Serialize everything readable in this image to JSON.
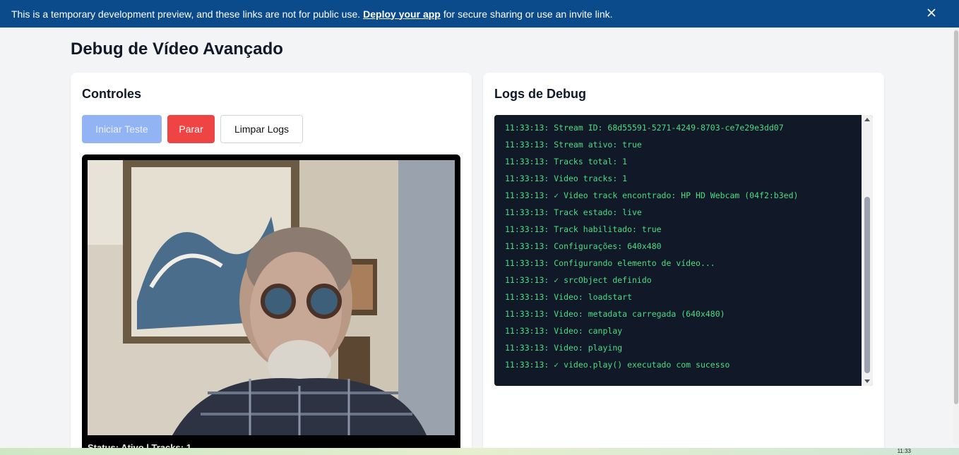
{
  "banner": {
    "text_before": "This is a temporary development preview, and these links are not for public use.",
    "link": "Deploy your app",
    "text_after": "for secure sharing or use an invite link."
  },
  "page": {
    "title": "Debug de Vídeo Avançado"
  },
  "controls": {
    "title": "Controles",
    "start_label": "Iniciar Teste",
    "stop_label": "Parar",
    "clear_label": "Limpar Logs",
    "status": "Status: Ativo | Tracks: 1"
  },
  "logs": {
    "title": "Logs de Debug",
    "lines": [
      "11:33:13: Stream ID: 68d55591-5271-4249-8703-ce7e29e3dd07",
      "11:33:13: Stream ativo: true",
      "11:33:13: Tracks total: 1",
      "11:33:13: Video tracks: 1",
      "11:33:13: ✓ Video track encontrado: HP HD Webcam (04f2:b3ed)",
      "11:33:13: Track estado: live",
      "11:33:13: Track habilitado: true",
      "11:33:13: Configurações: 640x480",
      "11:33:13: Configurando elemento de vídeo...",
      "11:33:13: ✓ srcObject definido",
      "11:33:13: Video: loadstart",
      "11:33:13: Video: metadata carregada (640x480)",
      "11:33:13: Video: canplay",
      "11:33:13: Video: playing",
      "11:33:13: ✓ video.play() executado com sucesso"
    ]
  },
  "taskbar": {
    "clock": "11:33"
  },
  "icons": {
    "close": "close-icon"
  },
  "colors": {
    "banner": "#0b4a8b",
    "stop": "#ef4444",
    "start_disabled": "#93b4f4",
    "log_bg": "#111827",
    "log_text": "#4ade80"
  }
}
